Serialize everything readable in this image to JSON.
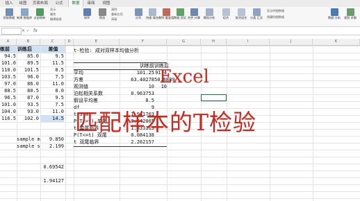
{
  "ribbon_tabs": [
    "插入",
    "绘图",
    "页面布局",
    "公式",
    "数据",
    "审阅",
    "视图"
  ],
  "active_tab": "数据",
  "ribbon": {
    "large_buttons": [
      "获取数据",
      "新建\n数据库查询",
      "全部刷新",
      "排序",
      "筛选",
      "分列",
      "快速\n填充",
      "删除\n重复值",
      "数据\n验证",
      "合并\n计算",
      "模拟分析",
      "组合",
      "取消组合",
      "分类\n汇总",
      "数据\n分析",
      "规划\n求解"
    ],
    "small_items": [
      "显示",
      "属性",
      "编辑链接",
      "清除",
      "重新应用",
      "高级",
      "显示明细数据",
      "隐藏明细数据"
    ]
  },
  "formula_bar": {
    "name_box": "",
    "fx": "fx",
    "content": ""
  },
  "columns": [
    "A",
    "B",
    "C",
    "D",
    "E",
    "F",
    "G",
    "H",
    "I",
    "J",
    "K"
  ],
  "col_a": {
    "header": "练前",
    "values": [
      "94.5",
      "101.0",
      "110.0",
      "103.5",
      "97.0",
      "88.5",
      "96.5",
      "101.0",
      "104.0",
      "116.5"
    ]
  },
  "col_b": {
    "header": "训练后",
    "values": [
      "85.0",
      "89.5",
      "101.5",
      "96.0",
      "86.0",
      "80.5",
      "87.0",
      "93.5",
      "93.0",
      "102.0"
    ]
  },
  "col_c": {
    "header": "差值",
    "values": [
      "9.5",
      "11.5",
      "8.5",
      "7.5",
      "11.0",
      "8.0",
      "9.5",
      "7.5",
      "11.0",
      "14.5"
    ]
  },
  "sample_stats": [
    {
      "label": "sample m",
      "value": "9.850"
    },
    {
      "label": "sample s",
      "value": "2.199"
    }
  ],
  "extra_values": [
    "0.69542",
    "1.94127"
  ],
  "analysis": {
    "title": "t-检验: 成对双样本均值分析",
    "col_headers": [
      "训练前",
      "训练后"
    ],
    "rows": [
      {
        "label": "平均",
        "v1": "101.25",
        "v2": "91.4"
      },
      {
        "label": "方差",
        "v1": "63.40278",
        "v2": "50.8889"
      },
      {
        "label": "观测值",
        "v1": "10",
        "v2": "10"
      },
      {
        "label": "泊松相关系数",
        "v1": "0.963753",
        "v2": ""
      },
      {
        "label": "假设平均差",
        "v1": "8.5",
        "v2": ""
      },
      {
        "label": "df",
        "v1": "9",
        "v2": ""
      },
      {
        "label": "t Stat",
        "v1": "1.941703",
        "v2": ""
      },
      {
        "label": "P(T<=t) 单尾",
        "v1": "0.042065",
        "v2": ""
      },
      {
        "label": "t 单尾临界",
        "v1": "1.833113",
        "v2": ""
      },
      {
        "label": "P(T<=t) 双尾",
        "v1": "0.084138",
        "v2": ""
      },
      {
        "label": "t 双尾临界",
        "v1": "2.262157",
        "v2": ""
      }
    ]
  },
  "overlay": {
    "line1": "Excel",
    "line2": "匹配样本的T检验"
  },
  "colors": {
    "accent": "#217346",
    "overlay": "#c8281e",
    "highlight": "#cfe1f3"
  }
}
